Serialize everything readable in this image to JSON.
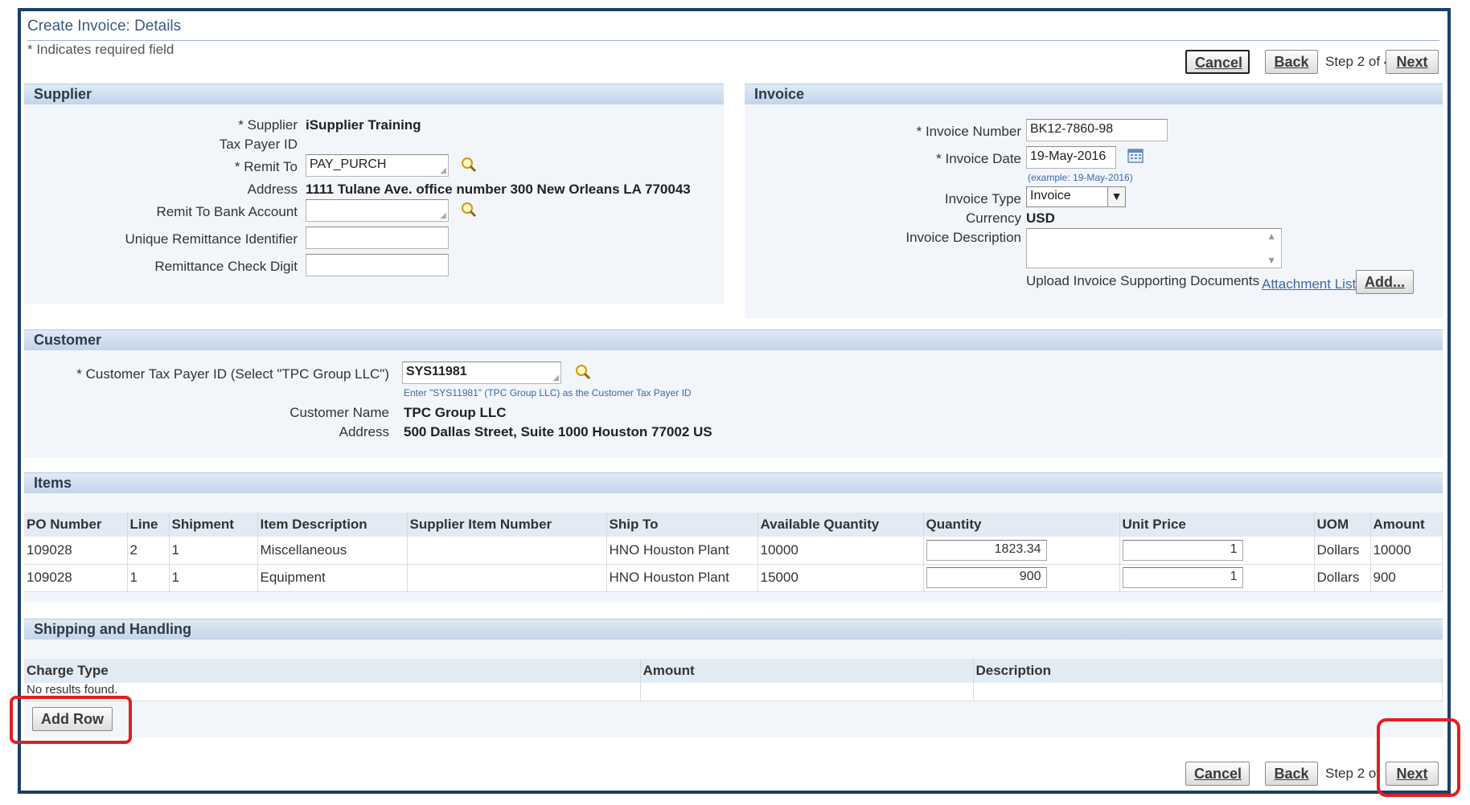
{
  "page": {
    "title": "Create Invoice: Details",
    "required_note": "* Indicates required field"
  },
  "nav": {
    "cancel": "Cancel",
    "back": "Back",
    "step": "Step 2 of 4",
    "next": "Next",
    "step_bottom": "Step 2 of 4"
  },
  "supplier": {
    "header": "Supplier",
    "supplier_label": "* Supplier",
    "supplier_value": "iSupplier Training",
    "taxpayer_label": "Tax Payer ID",
    "remit_to_label": "* Remit To",
    "remit_to_value": "PAY_PURCH",
    "address_label": "Address",
    "address_value": "1111 Tulane Ave. office number 300 New Orleans LA 770043",
    "bank_label": "Remit To Bank Account",
    "bank_value": "",
    "unique_label": "Unique Remittance Identifier",
    "unique_value": "",
    "check_label": "Remittance Check Digit",
    "check_value": ""
  },
  "invoice": {
    "header": "Invoice",
    "number_label": "* Invoice Number",
    "number_value": "BK12-7860-98",
    "date_label": "* Invoice Date",
    "date_value": "19-May-2016",
    "date_hint": "(example: 19-May-2016)",
    "type_label": "Invoice Type",
    "type_value": "Invoice",
    "currency_label": "Currency",
    "currency_value": "USD",
    "desc_label": "Invoice Description",
    "desc_value": "",
    "upload_label": "Upload Invoice Supporting Documents",
    "attachment_link": "Attachment List...",
    "add_button": "Add..."
  },
  "customer": {
    "header": "Customer",
    "taxpayer_label": "* Customer Tax Payer ID (Select \"TPC Group LLC\")",
    "taxpayer_value": "SYS11981",
    "hint": "Enter \"SYS11981\" (TPC Group LLC) as the Customer Tax Payer ID",
    "name_label": "Customer Name",
    "name_value": "TPC Group LLC",
    "address_label": "Address",
    "address_value": "500 Dallas Street, Suite 1000 Houston 77002 US"
  },
  "items": {
    "header": "Items",
    "columns": [
      "PO Number",
      "Line",
      "Shipment",
      "Item Description",
      "Supplier Item Number",
      "Ship To",
      "Available Quantity",
      "Quantity",
      "Unit Price",
      "UOM",
      "Amount"
    ],
    "rows": [
      {
        "po": "109028",
        "line": "2",
        "shipment": "1",
        "desc": "Miscellaneous",
        "supplier_item": "",
        "ship_to": "HNO Houston Plant",
        "available": "10000",
        "quantity": "1823.34",
        "unit_price": "1",
        "uom": "Dollars",
        "amount": "10000"
      },
      {
        "po": "109028",
        "line": "1",
        "shipment": "1",
        "desc": "Equipment",
        "supplier_item": "",
        "ship_to": "HNO Houston Plant",
        "available": "15000",
        "quantity": "900",
        "unit_price": "1",
        "uom": "Dollars",
        "amount": "900"
      }
    ]
  },
  "shipping": {
    "header": "Shipping and Handling",
    "columns": [
      "Charge Type",
      "Amount",
      "Description"
    ],
    "empty": "No results found.",
    "add_row": "Add Row"
  },
  "colors": {
    "frame": "#1a3f6b",
    "section_header": "#c2d5e8",
    "highlight": "#e02020",
    "link": "#3d68a8"
  }
}
